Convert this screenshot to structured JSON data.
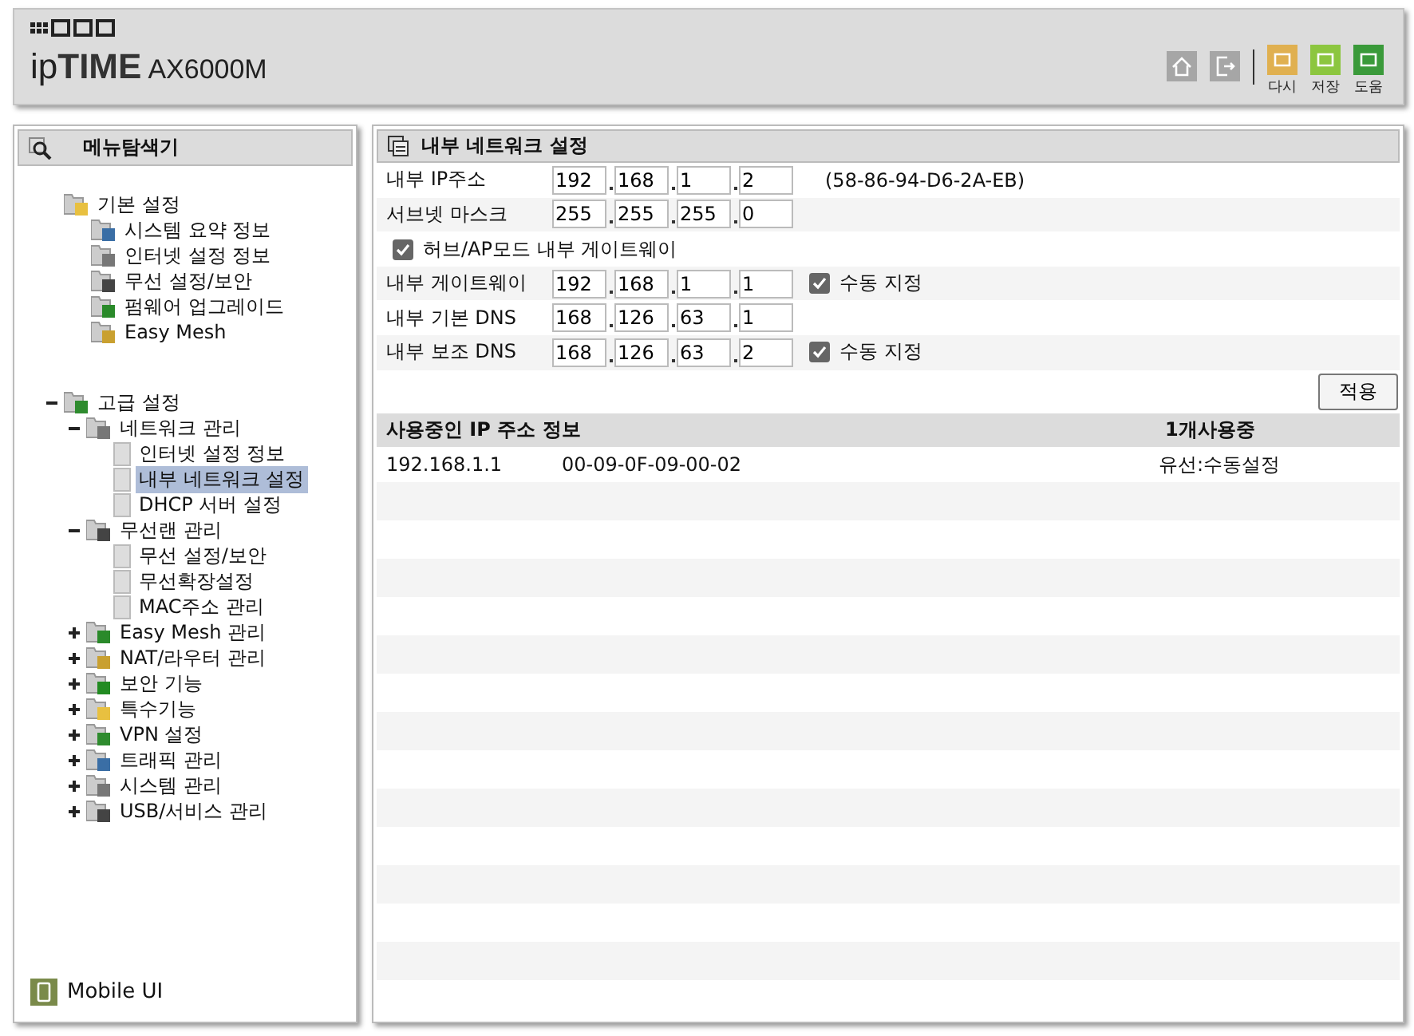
{
  "header": {
    "logo_prefix": "ip",
    "logo_brand": "TIME",
    "model": "AX6000M",
    "actions": [
      {
        "label": "다시",
        "color": "#e0b050"
      },
      {
        "label": "저장",
        "color": "#8cc63f"
      },
      {
        "label": "도움",
        "color": "#3a9a3a"
      }
    ]
  },
  "sidebar": {
    "title": "메뉴탐색기",
    "tree": [
      {
        "label": "기본 설정",
        "children": [
          {
            "label": "시스템 요약 정보",
            "selected": false
          },
          {
            "label": "인터넷 설정 정보",
            "selected": false
          },
          {
            "label": "무선 설정/보안",
            "selected": false
          },
          {
            "label": "펌웨어 업그레이드",
            "selected": false
          },
          {
            "label": "Easy Mesh",
            "selected": false
          }
        ]
      },
      {
        "label": "고급 설정",
        "expanded": true,
        "children": [
          {
            "label": "네트워크 관리",
            "expanded": true,
            "children": [
              {
                "label": "인터넷 설정 정보",
                "selected": false
              },
              {
                "label": "내부 네트워크 설정",
                "selected": true
              },
              {
                "label": "DHCP 서버 설정",
                "selected": false
              }
            ]
          },
          {
            "label": "무선랜 관리",
            "expanded": true,
            "children": [
              {
                "label": "무선 설정/보안",
                "selected": false
              },
              {
                "label": "무선확장설정",
                "selected": false
              },
              {
                "label": "MAC주소 관리",
                "selected": false
              }
            ]
          },
          {
            "label": "Easy Mesh 관리",
            "expanded": false
          },
          {
            "label": "NAT/라우터 관리",
            "expanded": false
          },
          {
            "label": "보안 기능",
            "expanded": false
          },
          {
            "label": "특수기능",
            "expanded": false
          },
          {
            "label": "VPN 설정",
            "expanded": false
          },
          {
            "label": "트래픽 관리",
            "expanded": false
          },
          {
            "label": "시스템 관리",
            "expanded": false
          },
          {
            "label": "USB/서비스 관리",
            "expanded": false
          }
        ]
      }
    ],
    "mobile_link": "Mobile UI"
  },
  "panel": {
    "title": "내부 네트워크 설정",
    "rows": [
      {
        "kind": "ip",
        "label": "내부 IP주소",
        "octets": [
          "192",
          "168",
          "1",
          "2"
        ],
        "note": "(58-86-94-D6-2A-EB)"
      },
      {
        "kind": "ip",
        "label": "서브넷 마스크",
        "octets": [
          "255",
          "255",
          "255",
          "0"
        ]
      },
      {
        "kind": "checkbox",
        "label": "허브/AP모드 내부 게이트웨이",
        "checked": true
      },
      {
        "kind": "ip",
        "label": "내부 게이트웨이",
        "octets": [
          "192",
          "168",
          "1",
          "1"
        ],
        "manual": {
          "label": "수동 지정",
          "checked": true
        }
      },
      {
        "kind": "ip",
        "label": "내부 기본 DNS",
        "octets": [
          "168",
          "126",
          "63",
          "1"
        ]
      },
      {
        "kind": "ip",
        "label": "내부 보조 DNS",
        "octets": [
          "168",
          "126",
          "63",
          "2"
        ],
        "manual": {
          "label": "수동 지정",
          "checked": true
        }
      }
    ],
    "apply_button": "적용",
    "leases": {
      "title": "사용중인 IP 주소 정보",
      "count": "1개사용중",
      "rows": [
        {
          "ip": "192.168.1.1",
          "mac": "00-09-0F-09-00-02",
          "type": "유선:수동설정"
        }
      ]
    }
  }
}
